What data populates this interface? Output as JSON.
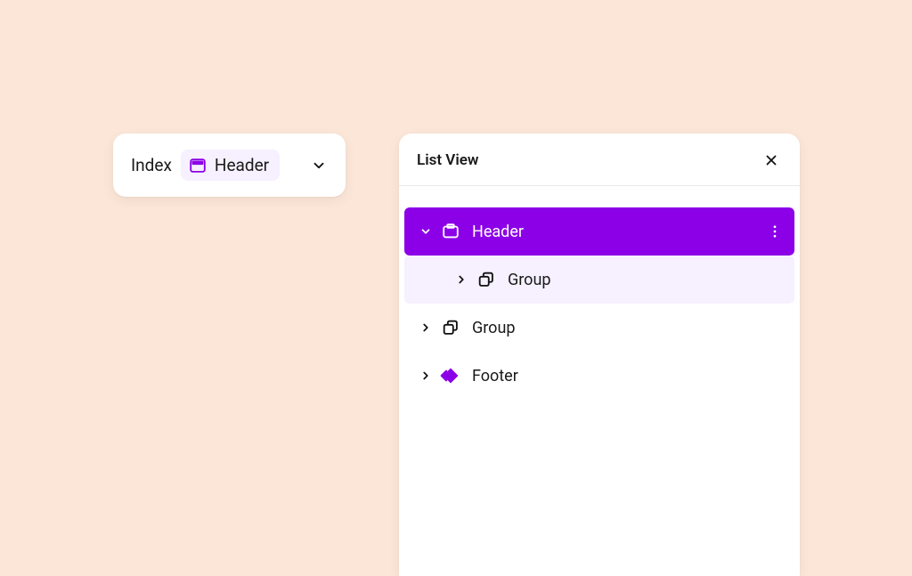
{
  "colors": {
    "accent": "#8c00e8",
    "accent_soft": "#f6f0ff",
    "background": "#fbe6d8"
  },
  "breadcrumb": {
    "root_label": "Index",
    "chip_label": "Header"
  },
  "list_view": {
    "title": "List View",
    "rows": [
      {
        "label": "Header",
        "icon": "header",
        "depth": 0,
        "state": "selected",
        "expanded": true,
        "has_more": true
      },
      {
        "label": "Group",
        "icon": "group",
        "depth": 1,
        "state": "hover",
        "expanded": false,
        "has_more": false
      },
      {
        "label": "Group",
        "icon": "group",
        "depth": 0,
        "state": "plain",
        "expanded": false,
        "has_more": false
      },
      {
        "label": "Footer",
        "icon": "footer",
        "depth": 0,
        "state": "plain",
        "expanded": false,
        "has_more": false
      }
    ]
  }
}
